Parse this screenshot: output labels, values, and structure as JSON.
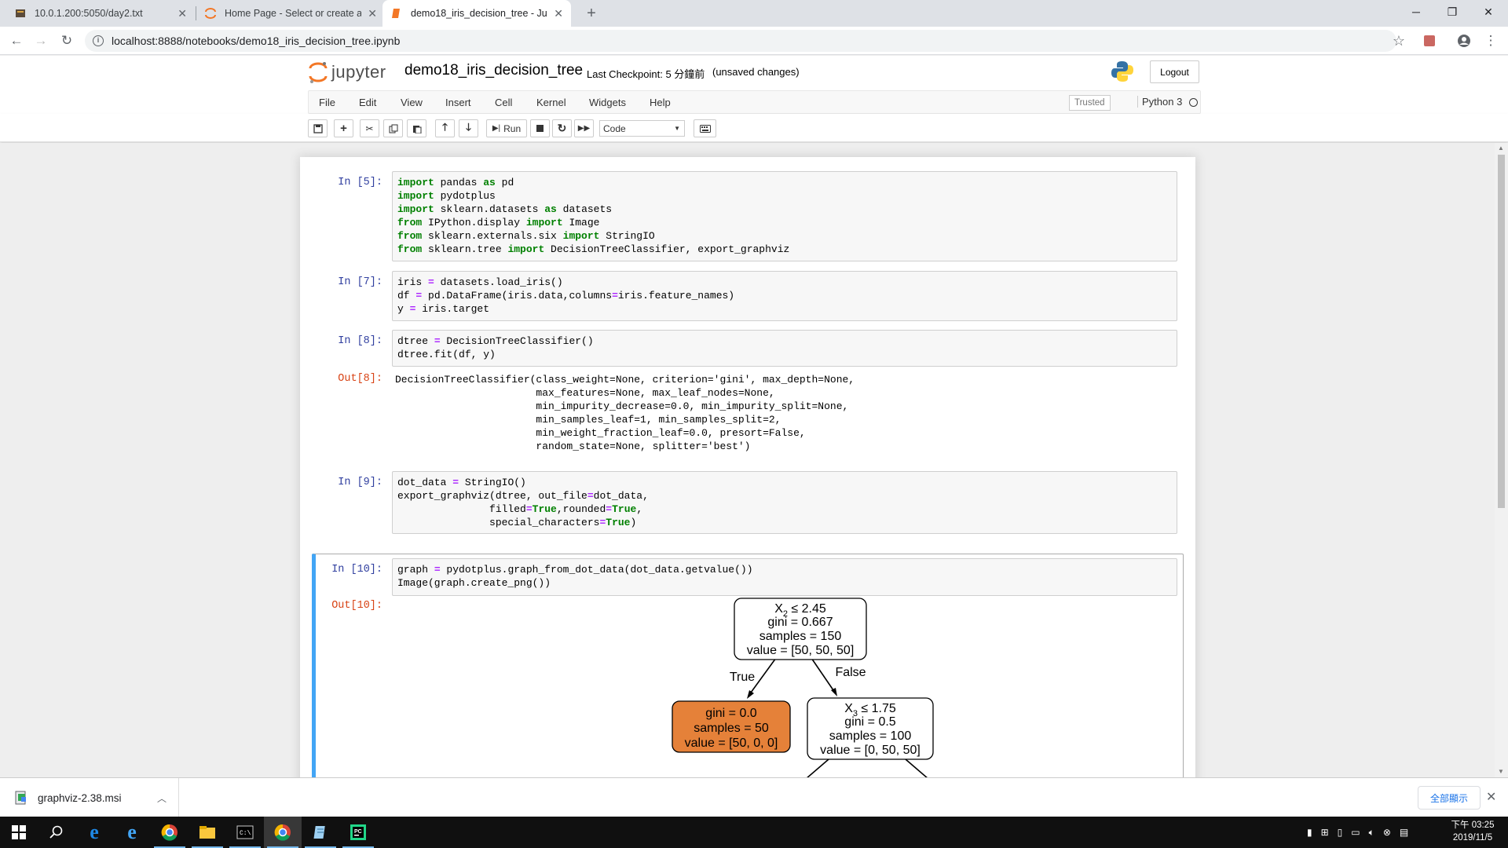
{
  "browser": {
    "tabs": [
      {
        "title": "10.0.1.200:5050/day2.txt",
        "icon": "page-icon",
        "active": false
      },
      {
        "title": "Home Page - Select or create a",
        "icon": "jupyter-icon",
        "active": false
      },
      {
        "title": "demo18_iris_decision_tree - Ju",
        "icon": "notebook-icon",
        "active": true
      }
    ],
    "url": "localhost:8888/notebooks/demo18_iris_decision_tree.ipynb"
  },
  "jupyter": {
    "logo_text": "jupyter",
    "notebook_title": "demo18_iris_decision_tree",
    "checkpoint": "Last Checkpoint: 5 分鐘前",
    "unsaved": "(unsaved changes)",
    "logout_label": "Logout",
    "menu": [
      "File",
      "Edit",
      "View",
      "Insert",
      "Cell",
      "Kernel",
      "Widgets",
      "Help"
    ],
    "trusted": "Trusted",
    "kernel": "Python 3",
    "toolbar": {
      "run_label": "Run",
      "cell_type": "Code"
    }
  },
  "cells": [
    {
      "prompt": "In [5]:"
    },
    {
      "prompt": "In [7]:"
    },
    {
      "prompt": "In [8]:",
      "out_prompt": "Out[8]:"
    },
    {
      "prompt": "In [9]:"
    },
    {
      "prompt": "In [10]:",
      "out_prompt": "Out[10]:"
    }
  ],
  "tree": {
    "root": {
      "line1": "X",
      "sub": "2",
      "line1b": " ≤ 2.45",
      "line2": "gini = 0.667",
      "line3": "samples = 150",
      "line4": "value = [50, 50, 50]"
    },
    "left": {
      "line1": "gini = 0.0",
      "line2": "samples = 50",
      "line3": "value = [50, 0, 0]"
    },
    "right": {
      "line1": "X",
      "sub": "3",
      "line1b": " ≤ 1.75",
      "line2": "gini = 0.5",
      "line3": "samples = 100",
      "line4": "value = [0, 50, 50]"
    },
    "true_label": "True",
    "false_label": "False"
  },
  "download": {
    "filename": "graphviz-2.38.msi",
    "show_all": "全部顯示"
  },
  "taskbar": {
    "time": "下午 03:25",
    "date": "2019/11/5"
  }
}
